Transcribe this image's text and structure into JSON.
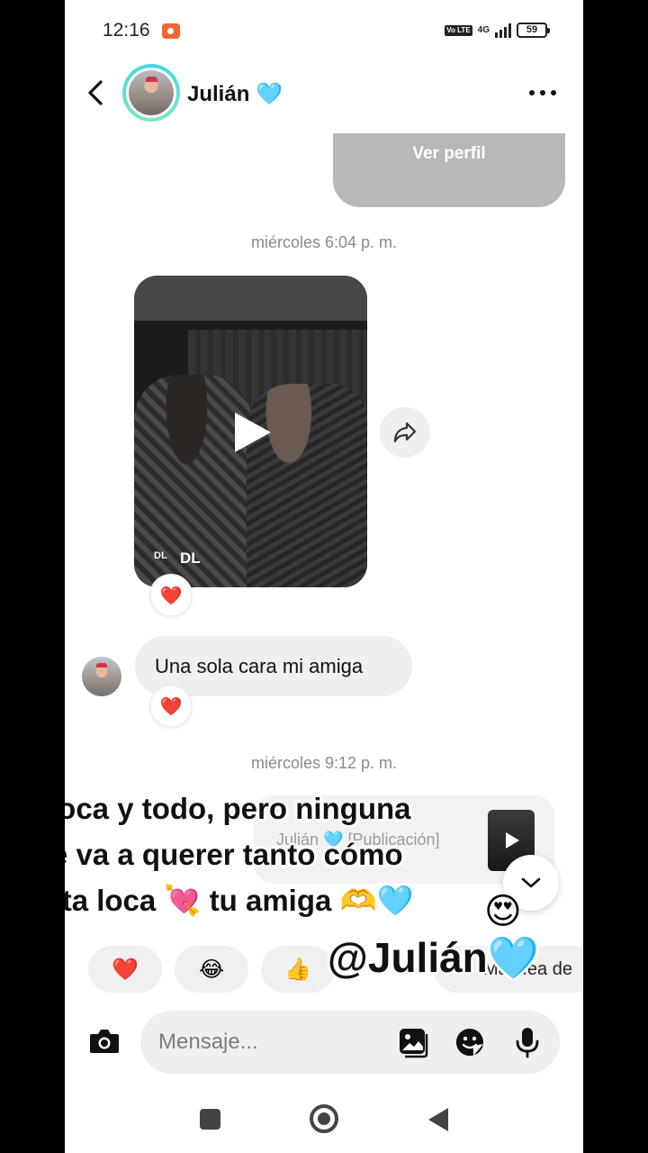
{
  "status_bar": {
    "time": "12:16",
    "network_type": "4G",
    "volte": "Vo LTE",
    "battery": "59"
  },
  "header": {
    "contact_name": "Julián",
    "name_emoji": "🩵"
  },
  "profile_card": {
    "button_label": "Ver perfil"
  },
  "messages": [
    {
      "timestamp": "miércoles 6:04 p. m."
    },
    {
      "video_source": "DL",
      "reaction": "❤️"
    },
    {
      "text": "Una sola cara mi amiga",
      "reaction": "❤️"
    },
    {
      "timestamp": "miércoles 9:12 p. m."
    }
  ],
  "shared_post": {
    "label": "Julián 🩵 [Publicación]"
  },
  "overlay": {
    "caption_line1": "Loca y todo, pero ninguna",
    "caption_line2": "te va a querer tanto cómo",
    "caption_line3": "esta loca 💘 tu amiga 🫶🩵",
    "hearts_emoji": "😍",
    "mention": "@Julián🩵"
  },
  "quick_reactions": {
    "items": [
      "❤️",
      "😂",
      "👍"
    ],
    "text_chip": "Más fea de"
  },
  "composer": {
    "placeholder": "Mensaje..."
  },
  "colors": {
    "accent_ring": "#3dd6e6",
    "heart": "#e0243c",
    "bubble": "#efefef"
  }
}
